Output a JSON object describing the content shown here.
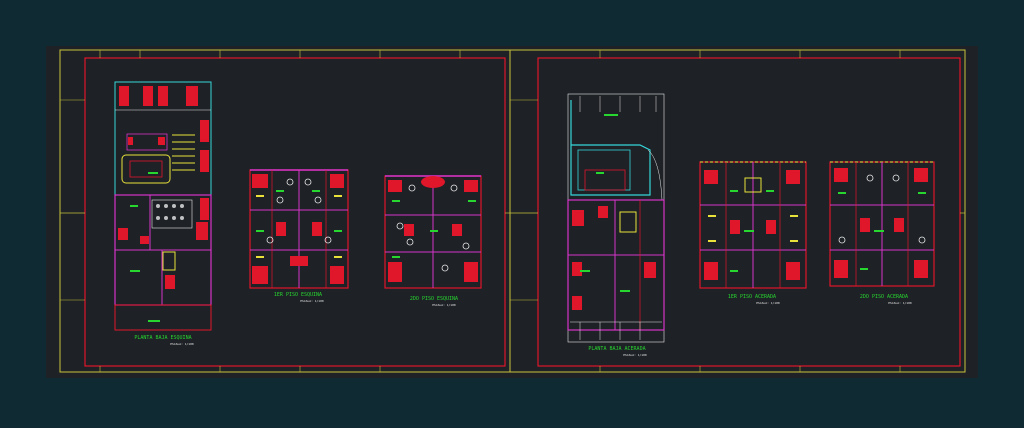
{
  "colors": {
    "background": "#0f2a33",
    "sheet": "#1e2126",
    "outer_frame": "#c8c23a",
    "inner_frame": "#e0162b",
    "wall": "#e0162b",
    "partition": "#d535c8",
    "furniture": "#e8e23a",
    "label": "#27d62f",
    "cyan": "#35d6d8",
    "white": "#e8e8e8"
  },
  "sheets": [
    {
      "name": "left-sheet",
      "plans": [
        {
          "id": "planta-baja-esquina",
          "title": "PLANTA BAJA ESQUINA",
          "scale": "ESCALA: 1/100"
        },
        {
          "id": "1er-piso-esquina",
          "title": "1ER PISO ESQUINA",
          "scale": "ESCALA: 1/100"
        },
        {
          "id": "2do-piso-esquina",
          "title": "2DO PISO ESQUINA",
          "scale": "ESCALA: 1/100"
        }
      ]
    },
    {
      "name": "right-sheet",
      "plans": [
        {
          "id": "planta-baja-acerada",
          "title": "PLANTA BAJA ACERADA",
          "scale": "ESCALA: 1/100"
        },
        {
          "id": "1er-piso-acerada",
          "title": "1ER PISO ACERADA",
          "scale": "ESCALA: 1/100"
        },
        {
          "id": "2do-piso-acerada",
          "title": "2DO PISO ACERADA",
          "scale": "ESCALA: 1/100"
        }
      ]
    }
  ]
}
